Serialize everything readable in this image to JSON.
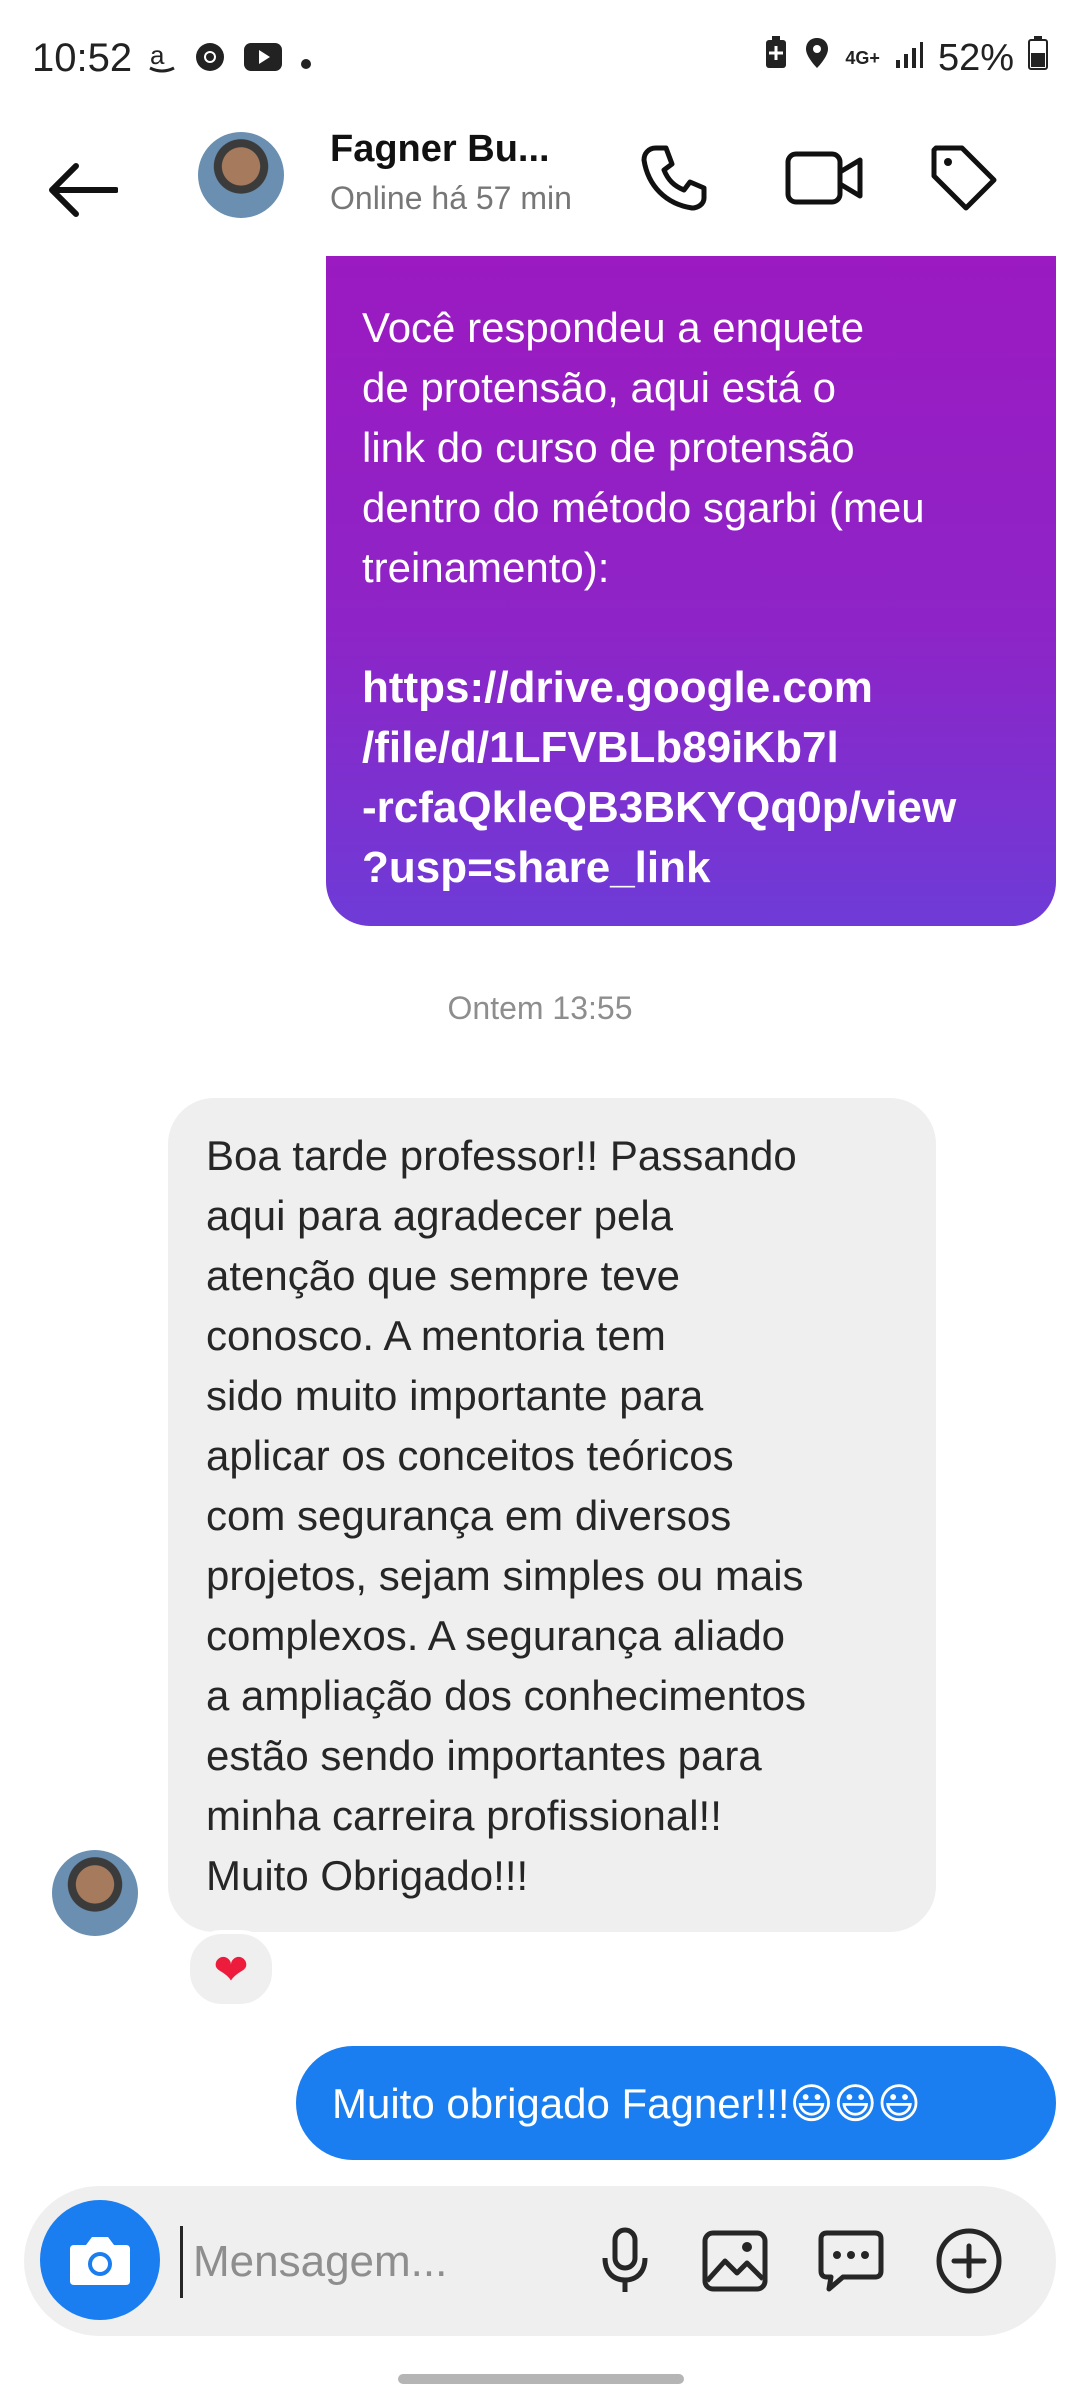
{
  "status_bar": {
    "time": "10:52",
    "network": "4G+",
    "battery": "52%",
    "icons_left": [
      "amazon-icon",
      "chrome-icon",
      "youtube-icon",
      "dot-icon"
    ],
    "icons_right": [
      "battery-saver-icon",
      "location-icon",
      "network-icon",
      "signal-icon",
      "battery-icon"
    ]
  },
  "header": {
    "contact_name": "Fagner Bu...",
    "status": "Online há 57 min",
    "icons": [
      "back-arrow-icon",
      "phone-icon",
      "video-icon",
      "tag-icon"
    ]
  },
  "messages": [
    {
      "type": "sent",
      "style": "purple-gradient",
      "text": "Você respondeu a enquete\nde protensão, aqui está o\nlink do curso de protensão\ndentro do método sgarbi (meu\ntreinamento):",
      "link": "https://drive.google.com\n/file/d/1LFVBLb89iKb7l\n-rcfaQkleQB3BKYQq0p/view\n?usp=share_link"
    },
    {
      "type": "timestamp",
      "text": "Ontem 13:55"
    },
    {
      "type": "received",
      "text": "Boa tarde professor!! Passando\naqui para agradecer pela\natenção que sempre teve\nconosco. A mentoria tem\nsido muito importante para\naplicar os conceitos teóricos\ncom segurança em diversos\nprojetos, sejam simples ou mais\ncomplexos. A segurança aliado\na ampliação dos conhecimentos\nestão sendo importantes para\nminha carreira profissional!!\nMuito Obrigado!!!",
      "reaction": "❤"
    },
    {
      "type": "sent",
      "style": "blue",
      "text": "Muito obrigado Fagner!!!😃😃😃"
    }
  ],
  "composer": {
    "placeholder": "Mensagem...",
    "icons": [
      "camera-icon",
      "microphone-icon",
      "gallery-icon",
      "sticker-icon",
      "plus-icon"
    ]
  },
  "colors": {
    "purple_top": "#9b1ac1",
    "purple_bottom": "#6e3bd7",
    "blue": "#1a7ef0",
    "gray_bubble": "#efefef"
  }
}
